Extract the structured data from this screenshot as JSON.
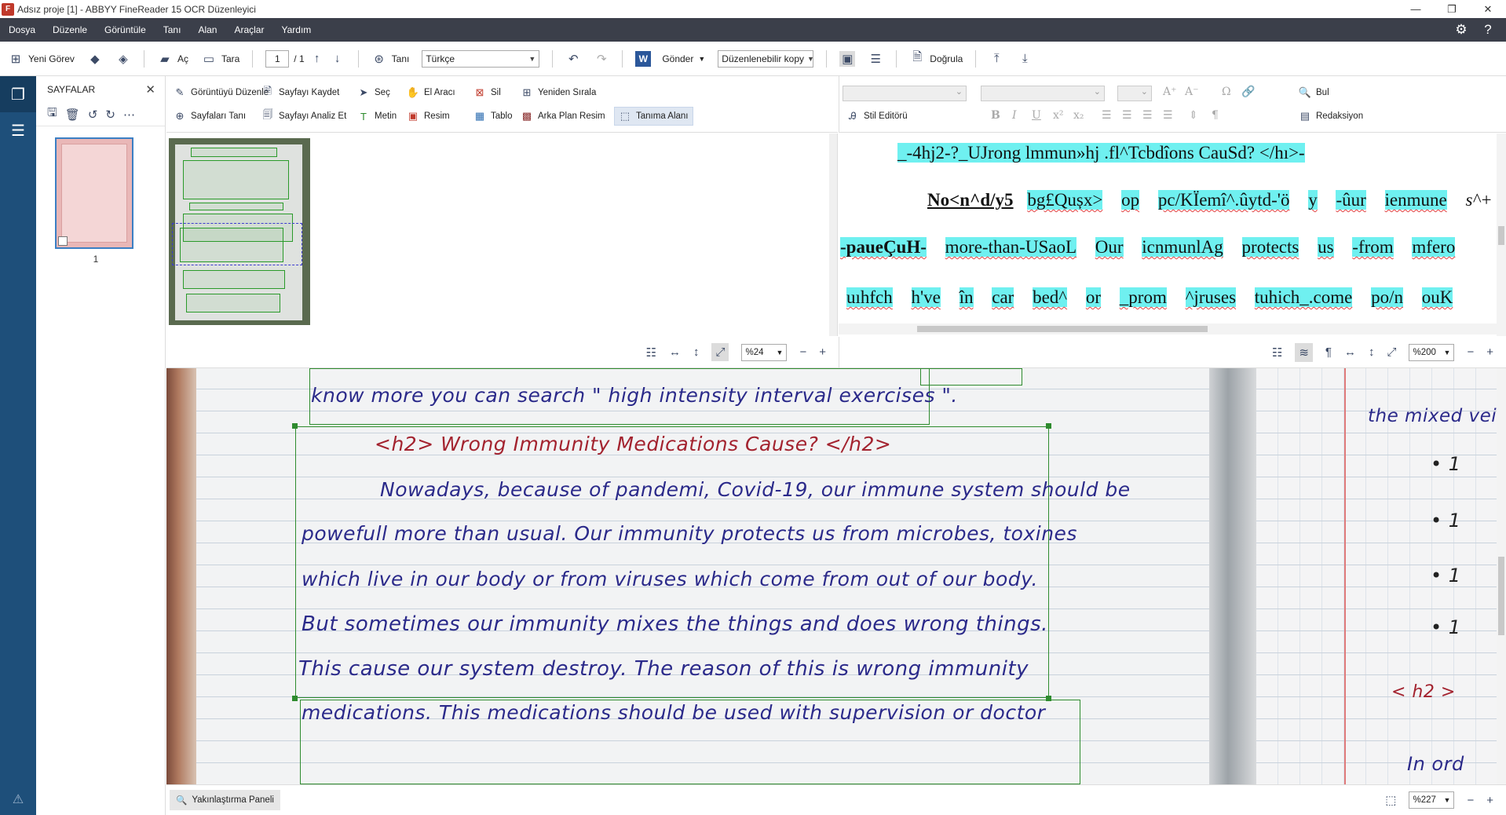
{
  "window": {
    "title": "Adsız proje [1] - ABBYY FineReader 15 OCR Düzenleyici",
    "app_icon_label": "F"
  },
  "menu": [
    "Dosya",
    "Düzenle",
    "Görüntüle",
    "Tanı",
    "Alan",
    "Araçlar",
    "Yardım"
  ],
  "toolbar": {
    "new_task": "Yeni Görev",
    "open": "Aç",
    "scan": "Tara",
    "page_current": "1",
    "page_total": "/ 1",
    "recognize": "Tanı",
    "language": "Türkçe",
    "send": "Gönder",
    "send_format": "Düzenlenebilir kopy",
    "verify": "Doğrula"
  },
  "pages_panel": {
    "title": "SAYFALAR",
    "page_number": "1"
  },
  "ribbon_left": {
    "edit_image": "Görüntüyü Düzenle",
    "save_page": "Sayfayı Kaydet",
    "select": "Seç",
    "hand_tool": "El Aracı",
    "delete": "Sil",
    "reorder": "Yeniden Sırala",
    "recognize_pages": "Sayfaları Tanı",
    "analyze_page": "Sayfayı Analiz Et",
    "text": "Metin",
    "picture": "Resim",
    "table": "Tablo",
    "background_picture": "Arka Plan Resim",
    "recognition_area": "Tanıma Alanı"
  },
  "ribbon_right": {
    "style_editor": "Stil Editörü",
    "find": "Bul",
    "redaction": "Redaksiyon"
  },
  "ocr_text": {
    "line1": "_-4hj2-?_UJrong lmmun»hj .fl^Tcbdîons CauSd? </hı>-",
    "line2_bold": "No<n^d/y5",
    "line2": [
      "bg£Qușx>",
      "op",
      "pc/KÏemî^.ûytd-'ö",
      "y",
      "-ûur",
      "ienmune"
    ],
    "line2_end": "s^+",
    "line3": [
      "-paueÇuH-",
      "more-than-USaoL",
      "Our",
      "icnmunlAg",
      "protects",
      "us",
      "-from",
      "mfero"
    ],
    "line4": [
      "uıhfch",
      "h've",
      "în",
      "car",
      "bed^",
      "or",
      "_prom",
      "^jruses",
      "tuhich_.come",
      "po/n",
      "ouK"
    ]
  },
  "zoom": {
    "thumbnail": "%24",
    "text": "%200",
    "image": "%227"
  },
  "handwriting": {
    "line0": "know more you can search \" high intensity interval exercises \".",
    "heading": "<h2> Wrong Immunity Medications Cause? </h2>",
    "line1": "Nowadays, because of pandemi, Covid-19, our immune system should be",
    "line2": "powefull more than usual. Our immunity protects us from microbes, toxines",
    "line3": "which live in our body or from viruses which come from out of our body.",
    "line4": "But sometimes our immunity mixes the things and does wrong things.",
    "line5": "This cause our system destroy. The reason of this is wrong immunity",
    "line6": "medications. This medications should be used with supervision or doctor",
    "right_top": "the mixed vei",
    "right_h2": "< h2 >",
    "right_bottom": "In ord",
    "right_bullets": [
      "• 1",
      "• 1",
      "• 1",
      "• 1"
    ]
  },
  "status": {
    "zoom_panel": "Yakınlaştırma Paneli"
  }
}
